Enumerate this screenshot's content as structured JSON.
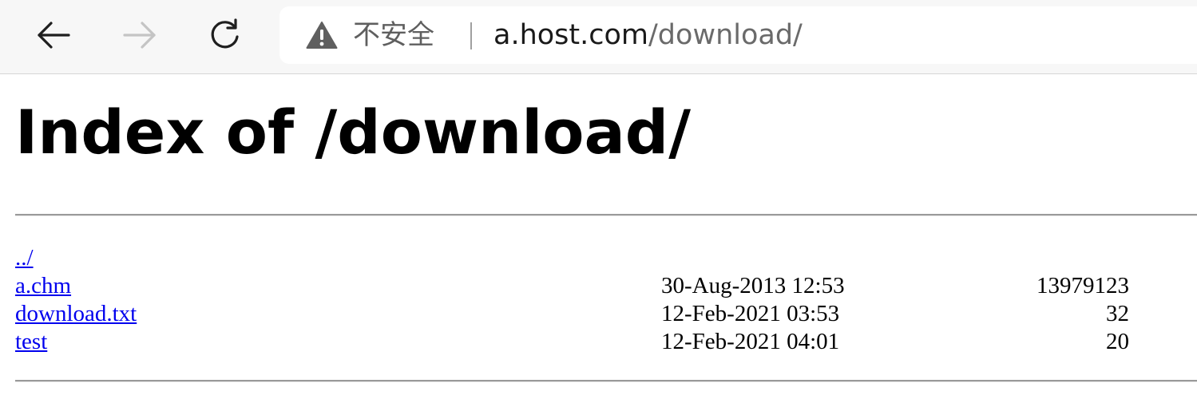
{
  "browser": {
    "back_icon": "arrow-left-icon",
    "forward_icon": "arrow-right-icon",
    "reload_icon": "reload-icon",
    "security_icon": "warning-triangle-icon",
    "security_label": "不安全",
    "url_host": "a.host.com",
    "url_path": "/download/"
  },
  "page": {
    "title": "Index of /download/",
    "link_color": "#0000ee",
    "entries": [
      {
        "name": "../",
        "date": "",
        "size": ""
      },
      {
        "name": "a.chm",
        "date": "30-Aug-2013 12:53",
        "size": "13979123"
      },
      {
        "name": "download.txt",
        "date": "12-Feb-2021 03:53",
        "size": "32"
      },
      {
        "name": "test",
        "date": "12-Feb-2021 04:01",
        "size": "20"
      }
    ]
  }
}
